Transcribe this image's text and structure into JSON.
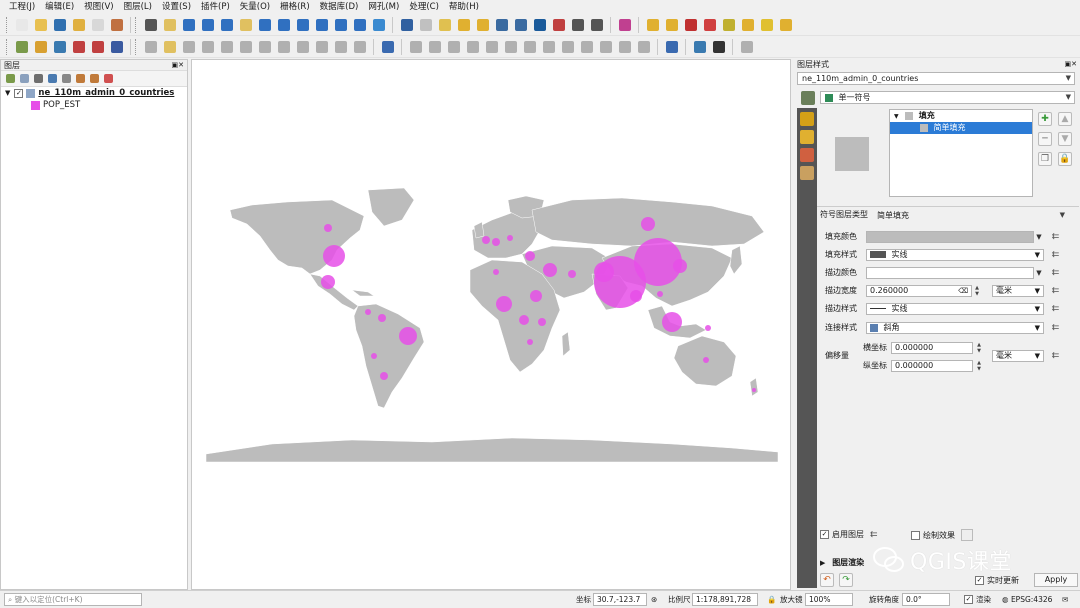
{
  "menu": [
    "工程(J)",
    "编辑(E)",
    "视图(V)",
    "图层(L)",
    "设置(S)",
    "插件(P)",
    "矢量(O)",
    "栅格(R)",
    "数据库(D)",
    "网孔(M)",
    "处理(C)",
    "帮助(H)"
  ],
  "layers_panel": {
    "title": "图层",
    "layer": {
      "name": "ne_110m_admin_0_countries",
      "checked": "✓",
      "color": "#8ea6c6"
    },
    "legend_item": {
      "label": "POP_EST",
      "color": "#e64fe8"
    }
  },
  "map": {
    "land_color": "#bcbcbc",
    "bubble_color": "#e64fe8"
  },
  "style_panel": {
    "title": "图层样式",
    "layer_combo": "ne_110m_admin_0_countries",
    "renderer": "单一符号",
    "tree": {
      "fill": "填充",
      "simple_fill": "简单填充"
    },
    "symbol_layer_type_label": "符号图层类型",
    "symbol_layer_type": "简单填充",
    "fill_color_label": "填充颜色",
    "fill_style_label": "填充样式",
    "fill_style": "实线",
    "stroke_color_label": "描边颜色",
    "stroke_width_label": "描边宽度",
    "stroke_width": "0.260000",
    "stroke_width_unit": "毫米",
    "stroke_style_label": "描边样式",
    "stroke_style": "实线",
    "join_style_label": "连接样式",
    "join_style": "斜角",
    "offset_label": "偏移量",
    "offset_x_label": "横坐标",
    "offset_x": "0.000000",
    "offset_y_label": "纵坐标",
    "offset_y": "0.000000",
    "offset_unit": "毫米",
    "enable_layer": "启用图层",
    "draw_effects": "绘制效果",
    "layer_rendering": "图层渲染",
    "live_update": "实时更新",
    "apply": "Apply",
    "fill_color": "#bcbcbc",
    "checked": "✓"
  },
  "statusbar": {
    "search_placeholder": "键入以定位(Ctrl+K)",
    "coord_label": "坐标",
    "coord_value": "30.7,-123.7",
    "scale_label": "比例尺",
    "scale_value": "1:178,891,728",
    "magnifier_label": "放大镜",
    "magnifier_value": "100%",
    "rotation_label": "旋转角度",
    "rotation_value": "0.0°",
    "render_label": "渲染",
    "render_checked": "✓",
    "crs": "EPSG:4326"
  },
  "watermark": "QGIS课堂"
}
